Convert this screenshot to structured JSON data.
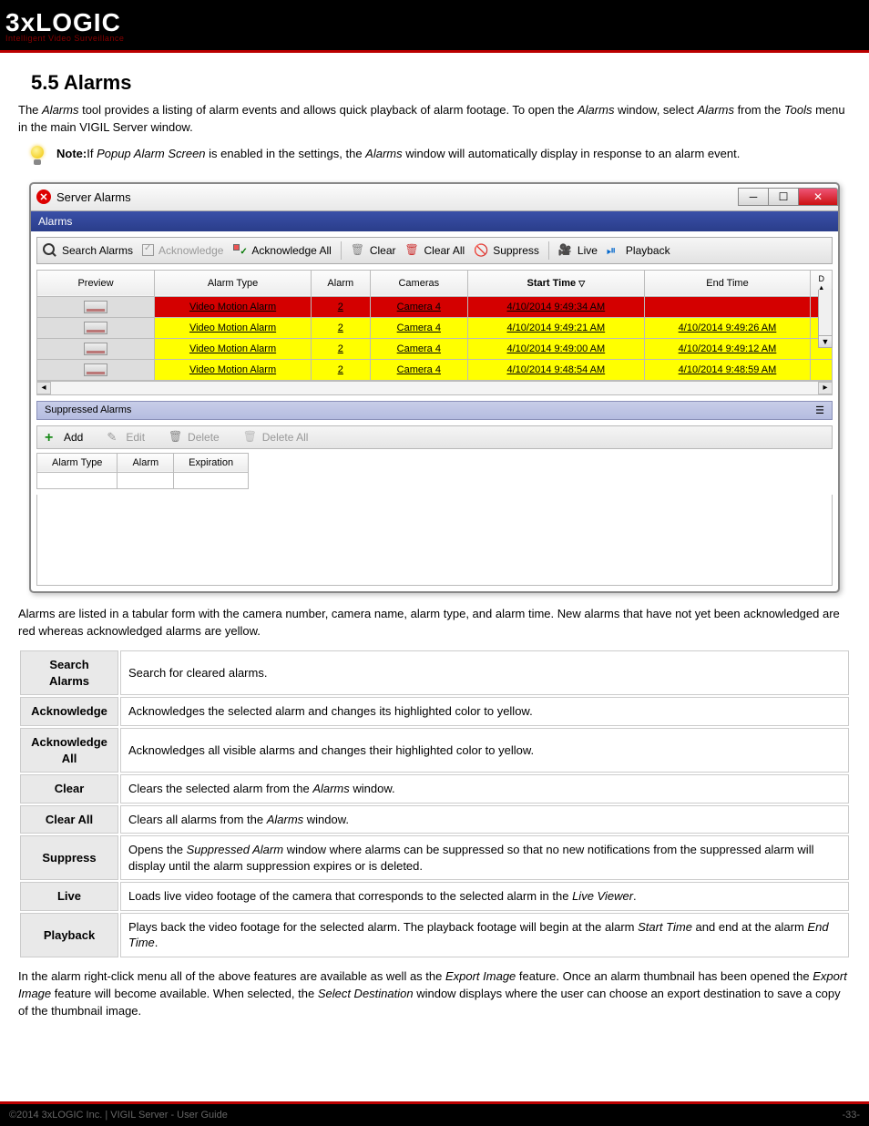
{
  "logo": {
    "main": "3xLOGIC",
    "sub": "Intelligent Video Surveillance"
  },
  "section": {
    "title": "5.5 Alarms"
  },
  "intro": {
    "p1a": "The ",
    "p1b": "Alarms",
    "p1c": " tool provides a listing of alarm events and allows quick playback of alarm footage. To open the ",
    "p1d": "Alarms",
    "p1e": " window, select ",
    "p1f": "Alarms",
    "p1g": " from the ",
    "p1h": "Tools",
    "p1i": " menu in the main VIGIL Server window."
  },
  "note": {
    "label": "Note:",
    "a": "If ",
    "b": "Popup Alarm Screen",
    "c": " is enabled in the settings, the ",
    "d": "Alarms",
    "e": " window will automatically display in response to an alarm event."
  },
  "window": {
    "title": "Server Alarms",
    "menu": "Alarms",
    "toolbar": {
      "search": "Search Alarms",
      "ack": "Acknowledge",
      "ackall": "Acknowledge All",
      "clear": "Clear",
      "clearall": "Clear All",
      "suppress": "Suppress",
      "live": "Live",
      "playback": "Playback"
    },
    "headers": {
      "preview": "Preview",
      "type": "Alarm Type",
      "alarm": "Alarm",
      "cameras": "Cameras",
      "start": "Start Time",
      "end": "End Time"
    },
    "rows": [
      {
        "cls": "red",
        "type": "Video Motion Alarm",
        "alarm": "2",
        "cam": "Camera 4",
        "start": "4/10/2014 9:49:34 AM",
        "end": ""
      },
      {
        "cls": "yellow",
        "type": "Video Motion Alarm",
        "alarm": "2",
        "cam": "Camera 4",
        "start": "4/10/2014 9:49:21 AM",
        "end": "4/10/2014 9:49:26 AM"
      },
      {
        "cls": "yellow",
        "type": "Video Motion Alarm",
        "alarm": "2",
        "cam": "Camera 4",
        "start": "4/10/2014 9:49:00 AM",
        "end": "4/10/2014 9:49:12 AM"
      },
      {
        "cls": "yellow",
        "type": "Video Motion Alarm",
        "alarm": "2",
        "cam": "Camera 4",
        "start": "4/10/2014 9:48:54 AM",
        "end": "4/10/2014 9:48:59 AM"
      }
    ],
    "suppressed": {
      "header": "Suppressed Alarms",
      "add": "Add",
      "edit": "Edit",
      "delete": "Delete",
      "deleteall": "Delete All",
      "cols": {
        "type": "Alarm Type",
        "alarm": "Alarm",
        "exp": "Expiration"
      }
    }
  },
  "desc1": "Alarms are listed in a tabular form with the camera number, camera name, alarm type, and alarm time. New alarms that have not yet been acknowledged are red whereas acknowledged alarms are yellow.",
  "defs": [
    {
      "term": "Search Alarms",
      "def": "Search for cleared alarms."
    },
    {
      "term": "Acknowledge",
      "def": "Acknowledges the selected alarm and changes its highlighted color to yellow."
    },
    {
      "term": "Acknowledge All",
      "def": "Acknowledges all visible alarms and changes their highlighted color to yellow."
    },
    {
      "term": "Clear",
      "def_a": "Clears the selected alarm from the ",
      "def_em": "Alarms",
      "def_b": " window."
    },
    {
      "term": "Clear All",
      "def_a": "Clears all alarms from the ",
      "def_em": "Alarms",
      "def_b": " window."
    },
    {
      "term": "Suppress",
      "def_a": "Opens the ",
      "def_em": "Suppressed Alarm",
      "def_b": " window where alarms can be suppressed so that no new notifications from the suppressed alarm will display until the alarm suppression expires or is deleted."
    },
    {
      "term": "Live",
      "def_a": "Loads live video footage of the camera that corresponds to the selected alarm in the ",
      "def_em": "Live Viewer",
      "def_b": "."
    },
    {
      "term": "Playback",
      "def_a": "Plays back the video footage for the selected alarm. The playback footage will begin at the alarm ",
      "def_em": "Start Time",
      "def_b": " and end at the alarm ",
      "def_em2": "End Time",
      "def_c": "."
    }
  ],
  "desc2": {
    "a": "In the alarm right-click menu all of the above features are available as well as the ",
    "b": "Export Image",
    "c": " feature. Once an alarm thumbnail has been opened the ",
    "d": "Export Image",
    "e": " feature will become available. When selected, the ",
    "f": "Select Destination",
    "g": " window displays where the user can choose an export destination to save a copy of the thumbnail image."
  },
  "footer": {
    "left": "©2014 3xLOGIC Inc.  |  VIGIL Server - User Guide",
    "right": "-33-"
  }
}
